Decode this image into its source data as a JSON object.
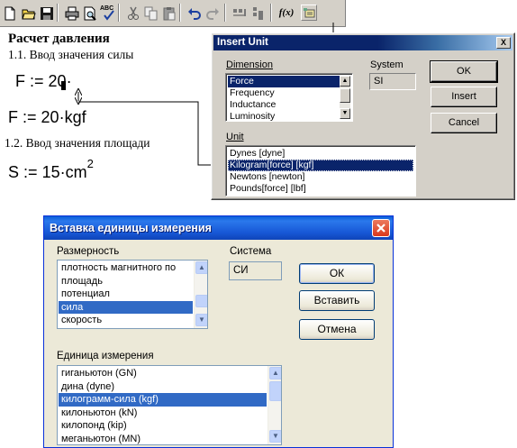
{
  "toolbar": {
    "fx_label": "f(x)",
    "abc_label": "ABC",
    "buttons": [
      "new",
      "open",
      "save",
      "print",
      "print-preview",
      "spell-check",
      "cut",
      "copy",
      "paste",
      "undo",
      "redo",
      "align",
      "align-down",
      "insert-function",
      "insert-unit"
    ]
  },
  "document": {
    "heading": "Расчет давления",
    "step1": "1.1. Ввод значения силы",
    "eq1_lhs": "F",
    "eq1_op": ":=",
    "eq1_rhs": "20·",
    "eq2_lhs": "F",
    "eq2_op": ":=",
    "eq2_rhs": "20·kgf",
    "step2": "1.2. Ввод значения площади",
    "eq3_lhs": "S",
    "eq3_op": ":=",
    "eq3_rhs": "15·cm",
    "eq3_exp": "2"
  },
  "insert_unit_en": {
    "title": "Insert Unit",
    "dimension_label": "Dimension",
    "dimension_items": [
      "Force",
      "Frequency",
      "Inductance",
      "Luminosity"
    ],
    "dimension_selected": 0,
    "system_label": "System",
    "system_value": "SI",
    "unit_label": "Unit",
    "unit_items": [
      "Dynes [dyne]",
      "Kilogram[force] [kgf]",
      "Newtons [newton]",
      "Pounds[force] [lbf]"
    ],
    "unit_selected": 1,
    "ok_label": "OK",
    "insert_label": "Insert",
    "cancel_label": "Cancel",
    "close_label": "X"
  },
  "insert_unit_ru": {
    "title": "Вставка единицы измерения",
    "dimension_label": "Размерность",
    "dimension_items": [
      "плотность магнитного по",
      "площадь",
      "потенциал",
      "сила",
      "скорость"
    ],
    "dimension_selected": 3,
    "system_label": "Система",
    "system_value": "СИ",
    "unit_label": "Единица измерения",
    "unit_items": [
      "гиганьютон (GN)",
      "дина (dyne)",
      "килограмм-сила (kgf)",
      "килоньютон (kN)",
      "килопонд (kip)",
      "меганьютон (MN)"
    ],
    "unit_selected": 2,
    "ok_label": "ОК",
    "insert_label": "Вставить",
    "cancel_label": "Отмена"
  },
  "colors": {
    "classic_title_from": "#0a246a",
    "classic_title_to": "#a6caf0",
    "classic_selection": "#0a246a",
    "xp_selection": "#316ac5",
    "xp_close": "#e04343"
  }
}
